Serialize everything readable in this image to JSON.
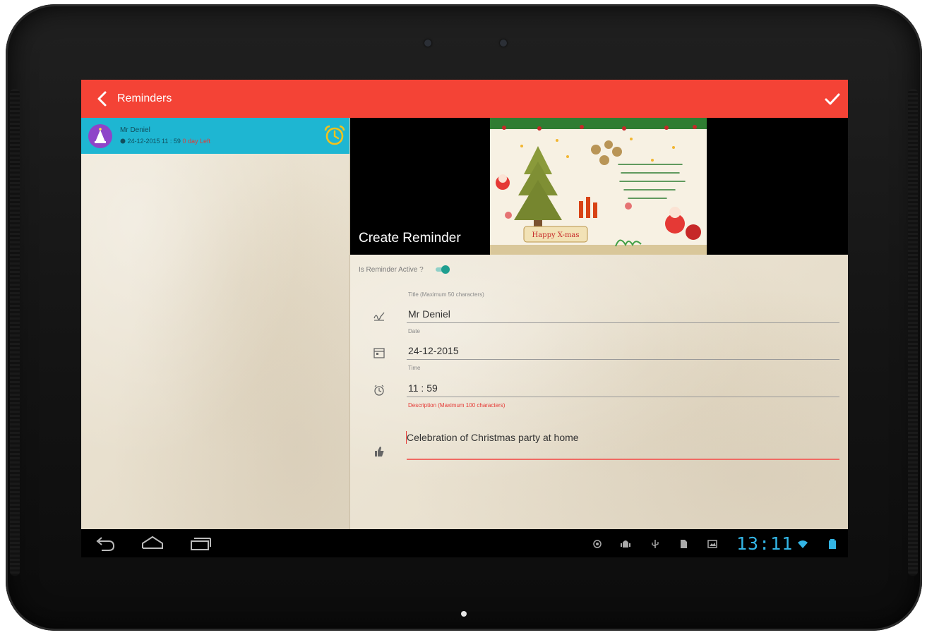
{
  "app_bar": {
    "title": "Reminders",
    "back_icon": "chevron-left-icon",
    "confirm_icon": "check-icon",
    "color": "#f44336"
  },
  "reminder_list": [
    {
      "title": "Mr Deniel",
      "datetime": "24-12-2015 11 : 59",
      "days_left": "0 day Left",
      "avatar_icon": "cake-icon",
      "alarm_icon": "alarm-clock-icon",
      "color": "#1eb6d2"
    }
  ],
  "create": {
    "heading": "Create Reminder",
    "card_image": "christmas-greeting-card",
    "card_text": "Happy X-mas"
  },
  "form": {
    "active_label": "Is Reminder Active ?",
    "active": true,
    "title_label": "Title (Maximum 50 characters)",
    "title_value": "Mr Deniel",
    "date_label": "Date",
    "date_value": "24-12-2015",
    "time_label": "Time",
    "time_value": "11 : 59",
    "desc_label": "Description (Maximum 100 characters)",
    "desc_value": "Celebration of Christmas party at home"
  },
  "system_bar": {
    "clock": "13:11",
    "nav_icons": [
      "back-icon",
      "home-icon",
      "recent-apps-icon"
    ],
    "status_icons": [
      "gps-icon",
      "android-debug-icon",
      "usb-icon",
      "sd-card-icon",
      "image-icon",
      "wifi-icon",
      "battery-icon"
    ]
  }
}
